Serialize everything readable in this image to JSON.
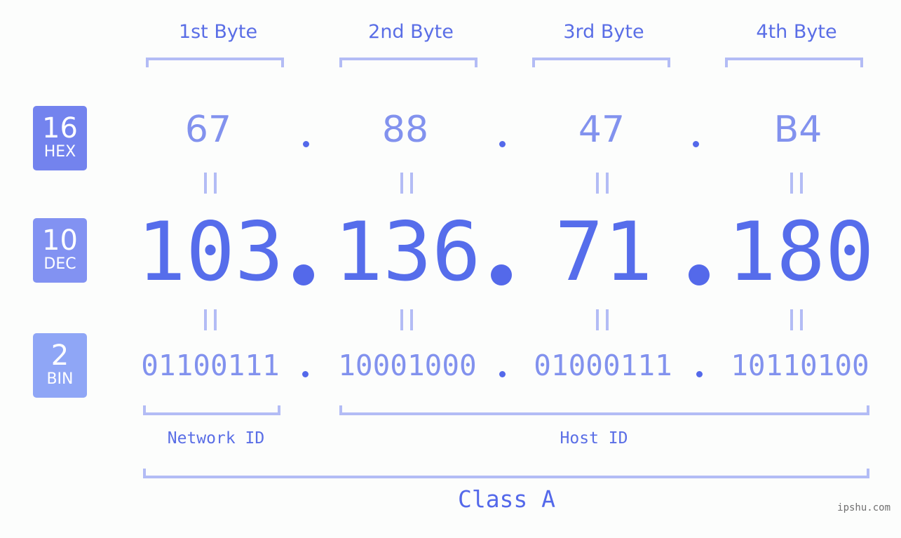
{
  "byte_headers": [
    "1st Byte",
    "2nd Byte",
    "3rd Byte",
    "4th Byte"
  ],
  "badges": {
    "hex": {
      "number": "16",
      "label": "HEX",
      "color": "#7383ee"
    },
    "dec": {
      "number": "10",
      "label": "DEC",
      "color": "#8292f2"
    },
    "bin": {
      "number": "2",
      "label": "BIN",
      "color": "#8fa6f6"
    }
  },
  "hex": [
    "67",
    "88",
    "47",
    "B4"
  ],
  "dec": [
    "103",
    "136",
    "71",
    "180"
  ],
  "bin": [
    "01100111",
    "10001000",
    "01000111",
    "10110100"
  ],
  "ip_address": "103.136.71.180",
  "network_id_label": "Network ID",
  "host_id_label": "Host ID",
  "class_label": "Class A",
  "watermark": "ipshu.com",
  "colors": {
    "primary": "#5469ea",
    "secondary": "#8292ee",
    "bracket": "#b3bcf5",
    "background": "#fcfdfc"
  }
}
